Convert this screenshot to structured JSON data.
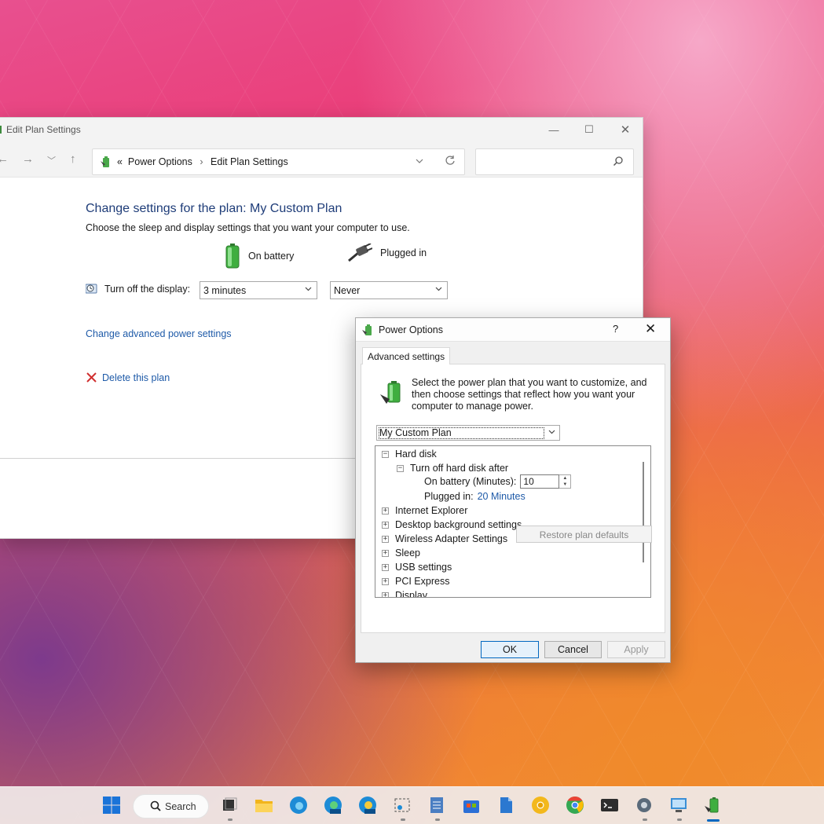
{
  "main_window": {
    "title": "Edit Plan Settings",
    "breadcrumb_prefix": "«",
    "breadcrumb": [
      "Power Options",
      "Edit Plan Settings"
    ],
    "breadcrumb_sep": "›",
    "heading": "Change settings for the plan: My Custom Plan",
    "subheading": "Choose the sleep and display settings that you want your computer to use.",
    "col_battery": "On battery",
    "col_plugged": "Plugged in",
    "display_label": "Turn off the display:",
    "display_battery_value": "3 minutes",
    "display_plugged_value": "Never",
    "advanced_link": "Change advanced power settings",
    "delete_link": "Delete this plan"
  },
  "dialog": {
    "title": "Power Options",
    "help": "?",
    "close": "✕",
    "tab": "Advanced settings",
    "description": "Select the power plan that you want to customize, and then choose settings that reflect how you want your computer to manage power.",
    "plan_selected": "My Custom Plan",
    "tree": {
      "hard_disk": "Hard disk",
      "turn_off_hd": "Turn off hard disk after",
      "on_battery_label": "On battery (Minutes):",
      "on_battery_value": "10",
      "plugged_label": "Plugged in:",
      "plugged_value": "20 Minutes",
      "items": [
        "Internet Explorer",
        "Desktop background settings",
        "Wireless Adapter Settings",
        "Sleep",
        "USB settings",
        "PCI Express",
        "Display"
      ]
    },
    "restore": "Restore plan defaults",
    "ok": "OK",
    "cancel": "Cancel",
    "apply": "Apply"
  },
  "taskbar": {
    "search_label": "Search",
    "icons": [
      "windows-start-icon",
      "task-view-icon",
      "file-explorer-icon",
      "edge-icon",
      "edge-beta-icon",
      "edge-canary-icon",
      "snipping-tool-icon",
      "notepad-icon",
      "store-icon",
      "wordpad-icon",
      "chrome-canary-icon",
      "chrome-icon",
      "terminal-icon",
      "settings-icon",
      "remote-desktop-icon",
      "power-options-icon"
    ]
  }
}
